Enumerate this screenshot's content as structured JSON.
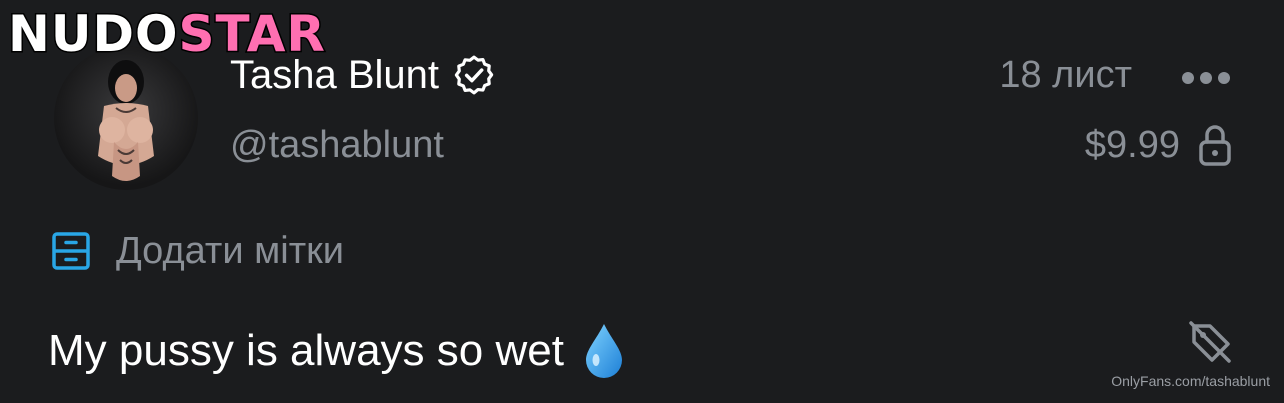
{
  "watermark": {
    "logo_part1": "NUDO",
    "logo_part2": "STAR",
    "logo_color_primary": "#ffffff",
    "logo_color_accent": "#ff6fb1",
    "url_text": "OnlyFans.com/tashablunt"
  },
  "post": {
    "author": {
      "display_name": "Tasha Blunt",
      "handle": "@tashablunt",
      "verified_icon": "verified-badge-icon",
      "avatar_icon": "avatar"
    },
    "date": "18 лист",
    "price": "$9.99",
    "lock_icon": "lock-icon",
    "more_icon": "more-horizontal-icon",
    "tags": {
      "icon": "label-drawer-icon",
      "label": "Додати мітки"
    },
    "text": "My pussy is always so wet",
    "emoji": "💧",
    "tag_off_icon": "tag-off-icon"
  },
  "colors": {
    "background": "#1b1c1e",
    "text_primary": "#ffffff",
    "text_secondary": "#8a8f96",
    "accent": "#29a6e6"
  }
}
